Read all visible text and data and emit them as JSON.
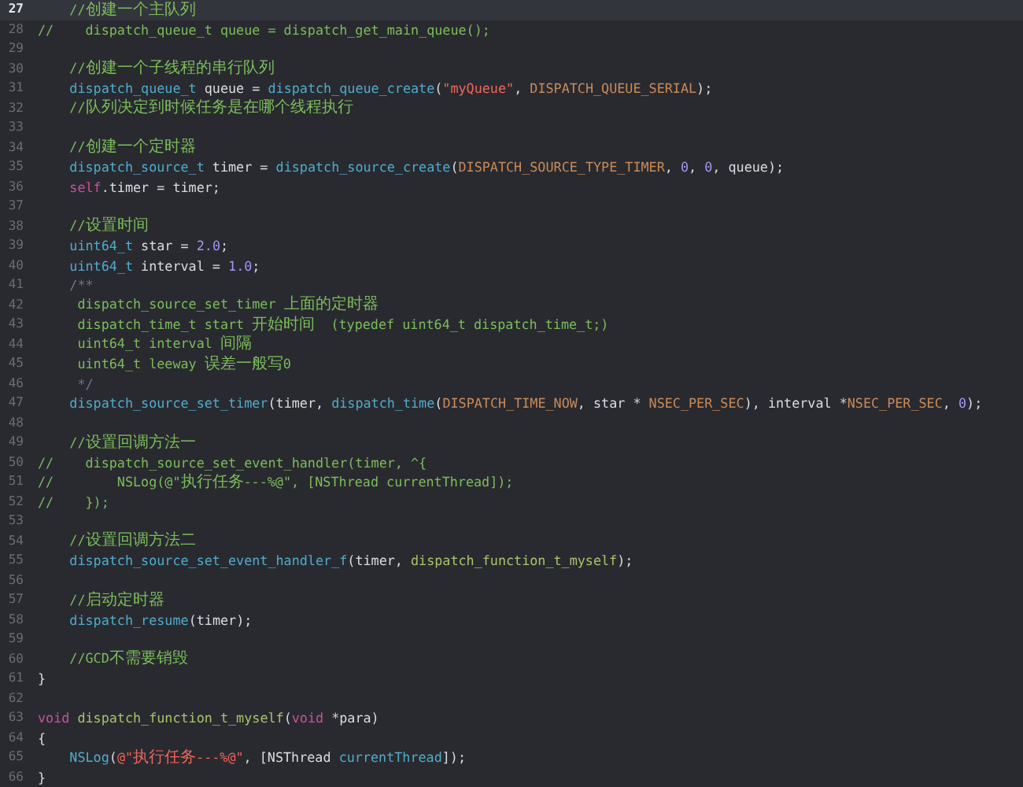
{
  "editor": {
    "lines": [
      {
        "number": "27",
        "current": true,
        "tokens": [
          {
            "kind": "comment",
            "text": "    //创建一个主队列"
          }
        ]
      },
      {
        "number": "28",
        "current": false,
        "tokens": [
          {
            "kind": "comment",
            "text": "//    dispatch_queue_t queue = dispatch_get_main_queue();"
          }
        ]
      },
      {
        "number": "29",
        "current": false
      },
      {
        "number": "30",
        "current": false,
        "tokens": [
          {
            "kind": "comment",
            "text": "    //创建一个子线程的串行队列"
          }
        ]
      },
      {
        "number": "31",
        "current": false,
        "tokens": [
          {
            "kind": "type",
            "text": "    dispatch_queue_t"
          },
          {
            "kind": "plain",
            "text": " queue = "
          },
          {
            "kind": "function",
            "text": "dispatch_queue_create"
          },
          {
            "kind": "plain",
            "text": "("
          },
          {
            "kind": "string",
            "text": "\"myQueue\""
          },
          {
            "kind": "plain",
            "text": ", "
          },
          {
            "kind": "macro",
            "text": "DISPATCH_QUEUE_SERIAL"
          },
          {
            "kind": "plain",
            "text": ");"
          }
        ]
      },
      {
        "number": "32",
        "current": false,
        "tokens": [
          {
            "kind": "comment",
            "text": "    //队列决定到时候任务是在哪个线程执行"
          }
        ]
      },
      {
        "number": "33",
        "current": false
      },
      {
        "number": "34",
        "current": false,
        "tokens": [
          {
            "kind": "comment",
            "text": "    //创建一个定时器"
          }
        ]
      },
      {
        "number": "35",
        "current": false,
        "tokens": [
          {
            "kind": "type",
            "text": "    dispatch_source_t"
          },
          {
            "kind": "plain",
            "text": " timer = "
          },
          {
            "kind": "function",
            "text": "dispatch_source_create"
          },
          {
            "kind": "plain",
            "text": "("
          },
          {
            "kind": "macro",
            "text": "DISPATCH_SOURCE_TYPE_TIMER"
          },
          {
            "kind": "plain",
            "text": ", "
          },
          {
            "kind": "number",
            "text": "0"
          },
          {
            "kind": "plain",
            "text": ", "
          },
          {
            "kind": "number",
            "text": "0"
          },
          {
            "kind": "plain",
            "text": ", queue);"
          }
        ]
      },
      {
        "number": "36",
        "current": false,
        "tokens": [
          {
            "kind": "keyword",
            "text": "    self"
          },
          {
            "kind": "plain",
            "text": ".timer = timer;"
          }
        ]
      },
      {
        "number": "37",
        "current": false
      },
      {
        "number": "38",
        "current": false,
        "tokens": [
          {
            "kind": "comment",
            "text": "    //设置时间"
          }
        ]
      },
      {
        "number": "39",
        "current": false,
        "tokens": [
          {
            "kind": "type",
            "text": "    uint64_t"
          },
          {
            "kind": "plain",
            "text": " star = "
          },
          {
            "kind": "number",
            "text": "2.0"
          },
          {
            "kind": "plain",
            "text": ";"
          }
        ]
      },
      {
        "number": "40",
        "current": false,
        "tokens": [
          {
            "kind": "type",
            "text": "    uint64_t"
          },
          {
            "kind": "plain",
            "text": " interval = "
          },
          {
            "kind": "number",
            "text": "1.0"
          },
          {
            "kind": "plain",
            "text": ";"
          }
        ]
      },
      {
        "number": "41",
        "current": false,
        "tokens": [
          {
            "kind": "doc",
            "text": "    /**"
          }
        ]
      },
      {
        "number": "42",
        "current": false,
        "tokens": [
          {
            "kind": "comment",
            "text": "     dispatch_source_set_timer 上面的定时器"
          }
        ]
      },
      {
        "number": "43",
        "current": false,
        "tokens": [
          {
            "kind": "comment",
            "text": "     dispatch_time_t start 开始时间  (typedef uint64_t dispatch_time_t;)"
          }
        ]
      },
      {
        "number": "44",
        "current": false,
        "tokens": [
          {
            "kind": "comment",
            "text": "     uint64_t interval 间隔"
          }
        ]
      },
      {
        "number": "45",
        "current": false,
        "tokens": [
          {
            "kind": "comment",
            "text": "     uint64_t leeway 误差一般写0"
          }
        ]
      },
      {
        "number": "46",
        "current": false,
        "tokens": [
          {
            "kind": "doc",
            "text": "     */"
          }
        ]
      },
      {
        "number": "47",
        "current": false,
        "tokens": [
          {
            "kind": "function",
            "text": "    dispatch_source_set_timer"
          },
          {
            "kind": "plain",
            "text": "(timer, "
          },
          {
            "kind": "function",
            "text": "dispatch_time"
          },
          {
            "kind": "plain",
            "text": "("
          },
          {
            "kind": "macro",
            "text": "DISPATCH_TIME_NOW"
          },
          {
            "kind": "plain",
            "text": ", star * "
          },
          {
            "kind": "macro",
            "text": "NSEC_PER_SEC"
          },
          {
            "kind": "plain",
            "text": "), interval *"
          },
          {
            "kind": "macro",
            "text": "NSEC_PER_SEC"
          },
          {
            "kind": "plain",
            "text": ", "
          },
          {
            "kind": "number",
            "text": "0"
          },
          {
            "kind": "plain",
            "text": ");"
          }
        ]
      },
      {
        "number": "48",
        "current": false
      },
      {
        "number": "49",
        "current": false,
        "tokens": [
          {
            "kind": "comment",
            "text": "    //设置回调方法一"
          }
        ]
      },
      {
        "number": "50",
        "current": false,
        "tokens": [
          {
            "kind": "comment",
            "text": "//    dispatch_source_set_event_handler(timer, ^{"
          }
        ]
      },
      {
        "number": "51",
        "current": false,
        "tokens": [
          {
            "kind": "comment",
            "text": "//        NSLog(@\"执行任务---%@\", [NSThread currentThread]);"
          }
        ]
      },
      {
        "number": "52",
        "current": false,
        "tokens": [
          {
            "kind": "comment",
            "text": "//    });"
          }
        ]
      },
      {
        "number": "53",
        "current": false
      },
      {
        "number": "54",
        "current": false,
        "tokens": [
          {
            "kind": "comment",
            "text": "    //设置回调方法二"
          }
        ]
      },
      {
        "number": "55",
        "current": false,
        "tokens": [
          {
            "kind": "function",
            "text": "    dispatch_source_set_event_handler_f"
          },
          {
            "kind": "plain",
            "text": "(timer, "
          },
          {
            "kind": "project",
            "text": "dispatch_function_t_myself"
          },
          {
            "kind": "plain",
            "text": ");"
          }
        ]
      },
      {
        "number": "56",
        "current": false
      },
      {
        "number": "57",
        "current": false,
        "tokens": [
          {
            "kind": "comment",
            "text": "    //启动定时器"
          }
        ]
      },
      {
        "number": "58",
        "current": false,
        "tokens": [
          {
            "kind": "function",
            "text": "    dispatch_resume"
          },
          {
            "kind": "plain",
            "text": "(timer);"
          }
        ]
      },
      {
        "number": "59",
        "current": false
      },
      {
        "number": "60",
        "current": false,
        "tokens": [
          {
            "kind": "comment",
            "text": "    //GCD不需要销毁"
          }
        ]
      },
      {
        "number": "61",
        "current": false,
        "tokens": [
          {
            "kind": "plain",
            "text": "}"
          }
        ]
      },
      {
        "number": "62",
        "current": false
      },
      {
        "number": "63",
        "current": false,
        "tokens": [
          {
            "kind": "keyword",
            "text": "void "
          },
          {
            "kind": "project",
            "text": "dispatch_function_t_myself"
          },
          {
            "kind": "plain",
            "text": "("
          },
          {
            "kind": "keyword",
            "text": "void"
          },
          {
            "kind": "plain",
            "text": " *para)"
          }
        ]
      },
      {
        "number": "64",
        "current": false,
        "tokens": [
          {
            "kind": "plain",
            "text": "{"
          }
        ]
      },
      {
        "number": "65",
        "current": false,
        "tokens": [
          {
            "kind": "function",
            "text": "    NSLog"
          },
          {
            "kind": "plain",
            "text": "("
          },
          {
            "kind": "string",
            "text": "@\"执行任务---%@\""
          },
          {
            "kind": "plain",
            "text": ", [NSThread "
          },
          {
            "kind": "function",
            "text": "currentThread"
          },
          {
            "kind": "plain",
            "text": "]);"
          }
        ]
      },
      {
        "number": "66",
        "current": false,
        "tokens": [
          {
            "kind": "plain",
            "text": "}"
          }
        ]
      }
    ]
  }
}
